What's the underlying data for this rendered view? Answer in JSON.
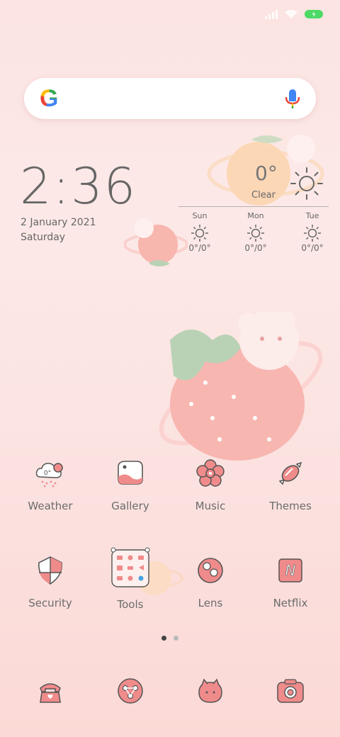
{
  "status_bar": {
    "battery_icon": "battery-charging-icon",
    "signal_icon": "signal-icon",
    "wifi_icon": "wifi-icon",
    "battery_color": "#4cd964"
  },
  "search": {
    "logo": "G",
    "mic_icon": "microphone-icon"
  },
  "clock": {
    "time": "2:36",
    "date": "2 January 2021",
    "day": "Saturday"
  },
  "weather": {
    "temp": "0°",
    "condition": "Clear",
    "forecast": [
      {
        "day": "Sun",
        "range": "0°/0°"
      },
      {
        "day": "Mon",
        "range": "0°/0°"
      },
      {
        "day": "Tue",
        "range": "0°/0°"
      }
    ]
  },
  "apps_row1": [
    {
      "label": "Weather",
      "icon": "weather-cloud-icon"
    },
    {
      "label": "Gallery",
      "icon": "gallery-icon"
    },
    {
      "label": "Music",
      "icon": "music-flower-icon"
    },
    {
      "label": "Themes",
      "icon": "candy-icon"
    }
  ],
  "apps_row2": [
    {
      "label": "Security",
      "icon": "shield-icon"
    },
    {
      "label": "Tools",
      "icon": "tools-folder-icon"
    },
    {
      "label": "Lens",
      "icon": "lens-icon"
    },
    {
      "label": "Netflix",
      "icon": "netflix-icon"
    }
  ],
  "weather_icon_temp": "0°",
  "netflix_letter": "N",
  "dock": [
    {
      "icon": "phone-icon"
    },
    {
      "icon": "share-icon"
    },
    {
      "icon": "messages-icon"
    },
    {
      "icon": "camera-icon"
    }
  ],
  "pages": {
    "count": 2,
    "current": 1
  },
  "accent": "#f08b8b"
}
